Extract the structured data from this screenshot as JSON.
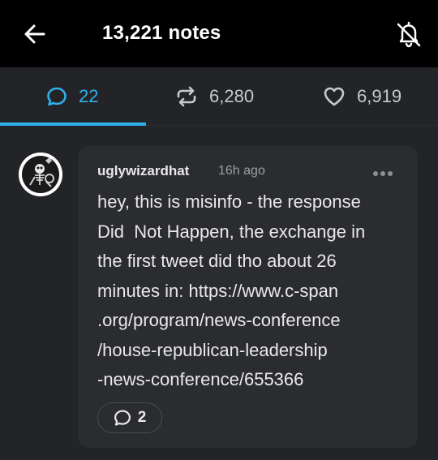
{
  "header": {
    "title": "13,221 notes"
  },
  "tabs": {
    "replies": "22",
    "reblogs": "6,280",
    "likes": "6,919"
  },
  "reply": {
    "username": "uglywizardhat",
    "timestamp": "16h ago",
    "lines": [
      "hey, this is misinfo - the response",
      "Did  Not Happen, the exchange in",
      "the first tweet did tho about 26",
      "minutes in: https://www.c-span",
      ".org/program/news-conference",
      "/house-republican-leadership",
      "-news-conference/655366"
    ],
    "reply_count": "2"
  },
  "colors": {
    "accent": "#2fb0ea",
    "background": "#232427",
    "card": "#2b2c2f",
    "topbar": "#000000"
  },
  "icons": [
    "back-arrow-icon",
    "bell-off-icon",
    "speech-bubble-icon",
    "reblog-icon",
    "heart-icon",
    "more-icon"
  ]
}
